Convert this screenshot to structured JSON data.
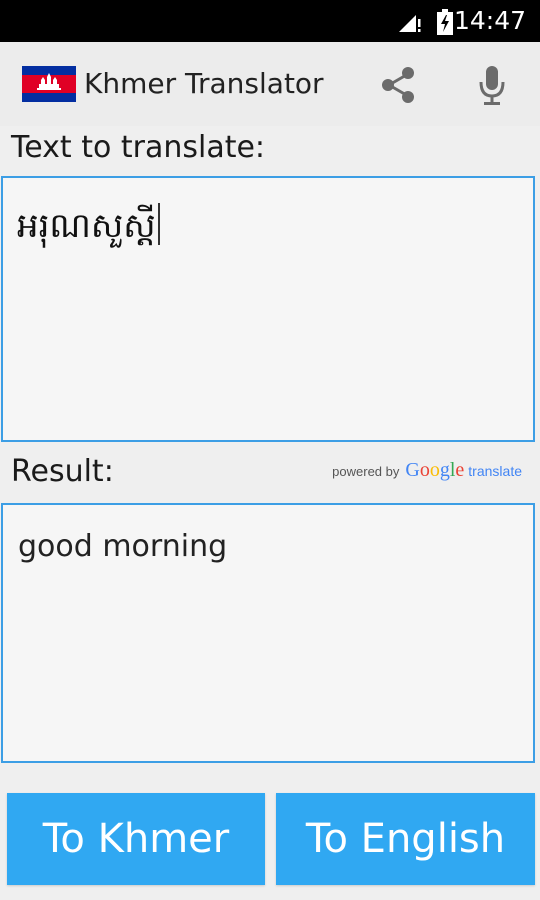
{
  "status_bar": {
    "time": "14:47",
    "signal_icon": "signal-icon",
    "battery_icon": "battery-charging-icon"
  },
  "action_bar": {
    "title": "Khmer Translator",
    "flag_icon": "cambodia-flag-icon",
    "share_icon": "share-icon",
    "mic_icon": "microphone-icon"
  },
  "input": {
    "label": "Text to translate:",
    "value": "អរុណសួស្តី"
  },
  "result": {
    "label": "Result:",
    "value": "good morning"
  },
  "attribution": {
    "prefix": "powered by",
    "brand_letters": [
      "G",
      "o",
      "o",
      "g",
      "l",
      "e"
    ],
    "suffix": "translate"
  },
  "buttons": {
    "to_khmer": "To Khmer",
    "to_english": "To English"
  },
  "colors": {
    "accent": "#30a8f2",
    "box_border": "#3c9ee5",
    "google_blue": "#4285f4",
    "google_red": "#ea4335",
    "google_yellow": "#fbbc05",
    "google_green": "#34a853"
  }
}
